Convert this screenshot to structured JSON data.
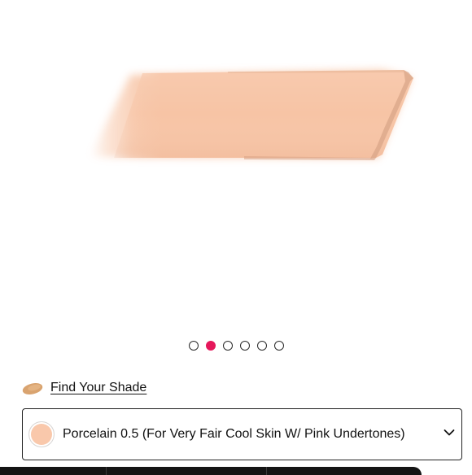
{
  "product_image": {
    "shade_color": "#f7c4a5"
  },
  "carousel": {
    "dot_count": 6,
    "active_index": 1,
    "active_color": "#e5185b"
  },
  "find_shade": {
    "label": "Find Your Shade",
    "icon": "swatch-swipe-icon"
  },
  "shade_selector": {
    "selected_label": "Porcelain 0.5 (For Very Fair Cool Skin W/ Pink Undertones)",
    "swatch_color": "#f9c8ab",
    "icon": "chevron-down-icon"
  }
}
